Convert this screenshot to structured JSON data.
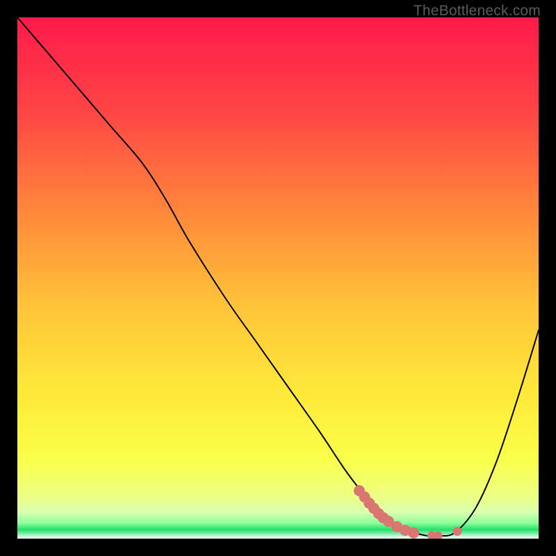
{
  "watermark": "TheBottleneck.com",
  "chart_data": {
    "type": "line",
    "title": "",
    "xlabel": "",
    "ylabel": "",
    "xlim": [
      0,
      100
    ],
    "ylim": [
      0,
      100
    ],
    "background_gradient": {
      "stops": [
        {
          "offset": 0,
          "color": "#ff1a4b"
        },
        {
          "offset": 18,
          "color": "#ff4545"
        },
        {
          "offset": 38,
          "color": "#ff8a3a"
        },
        {
          "offset": 55,
          "color": "#ffc23a"
        },
        {
          "offset": 72,
          "color": "#ffe93a"
        },
        {
          "offset": 85,
          "color": "#faff4a"
        },
        {
          "offset": 92,
          "color": "#ecff86"
        },
        {
          "offset": 95,
          "color": "#d9ffb0"
        },
        {
          "offset": 97,
          "color": "#8dff9a"
        },
        {
          "offset": 98.3,
          "color": "#22e06a"
        },
        {
          "offset": 100,
          "color": "#ffffff"
        }
      ]
    },
    "series": [
      {
        "name": "curve",
        "stroke": "#000000",
        "stroke_width": 2,
        "x": [
          0,
          6,
          12,
          18,
          24,
          28.5,
          33,
          40,
          46,
          52,
          58,
          63,
          67,
          69,
          71,
          74,
          77,
          79,
          81,
          84,
          88,
          92,
          96,
          100
        ],
        "y": [
          100,
          93,
          86,
          79,
          72,
          65,
          57,
          46,
          37.5,
          29,
          20.5,
          13,
          7.8,
          5.4,
          3.6,
          1.8,
          0.9,
          0.5,
          0.5,
          1.2,
          6,
          15,
          27,
          40
        ]
      }
    ],
    "markers": {
      "name": "highlight-dots",
      "fill": "#d9766f",
      "points": [
        {
          "x": 65.6,
          "y": 9.2,
          "r": 5
        },
        {
          "x": 66.6,
          "y": 8.0,
          "r": 5
        },
        {
          "x": 67.5,
          "y": 6.8,
          "r": 5
        },
        {
          "x": 68.4,
          "y": 5.8,
          "r": 5
        },
        {
          "x": 69.3,
          "y": 4.8,
          "r": 5
        },
        {
          "x": 70.2,
          "y": 4.0,
          "r": 5
        },
        {
          "x": 71.2,
          "y": 3.3,
          "r": 5
        },
        {
          "x": 72.8,
          "y": 2.3,
          "r": 5
        },
        {
          "x": 74.4,
          "y": 1.6,
          "r": 5
        },
        {
          "x": 76.0,
          "y": 1.1,
          "r": 5
        },
        {
          "x": 79.5,
          "y": 0.6,
          "r": 4
        },
        {
          "x": 80.7,
          "y": 0.55,
          "r": 4
        },
        {
          "x": 84.4,
          "y": 1.4,
          "r": 4
        }
      ]
    }
  }
}
